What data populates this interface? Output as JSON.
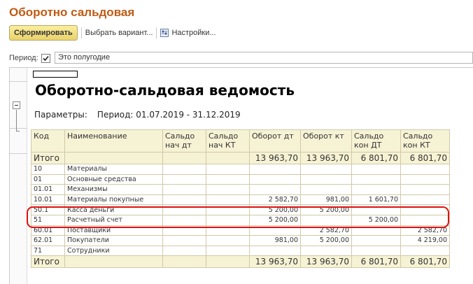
{
  "window": {
    "title": "Оборотно сальдовая"
  },
  "toolbar": {
    "generate_label": "Сформировать",
    "choose_variant_label": "Выбрать вариант...",
    "settings_label": "Настройки..."
  },
  "period": {
    "label": "Период:",
    "checked": true,
    "value": "Это полугодие"
  },
  "report": {
    "title": "Оборотно-сальдовая ведомость",
    "params_label": "Параметры:",
    "params_value": "Период: 01.07.2019 - 31.12.2019",
    "columns": [
      "Код",
      "Наименование",
      "Сальдо нач дт",
      "Сальдо нач КТ",
      "Оборот дт",
      "Оборот кт",
      "Сальдо кон ДТ",
      "Сальдо кон КТ"
    ],
    "total_top": [
      "Итого",
      "",
      "",
      "",
      "13 963,70",
      "13 963,70",
      "6 801,70",
      "6 801,70"
    ],
    "rows": [
      [
        "10",
        "Материалы",
        "",
        "",
        "",
        "",
        "",
        ""
      ],
      [
        "01",
        "Основные средства",
        "",
        "",
        "",
        "",
        "",
        ""
      ],
      [
        "01.01",
        "Механизмы",
        "",
        "",
        "",
        "",
        "",
        ""
      ],
      [
        "10.01",
        "Материалы покупные",
        "",
        "",
        "2 582,70",
        "981,00",
        "1 601,70",
        ""
      ],
      [
        "50.1",
        "Касса деньги",
        "",
        "",
        "5 200,00",
        "5 200,00",
        "",
        ""
      ],
      [
        "51",
        "Расчетный счет",
        "",
        "",
        "5 200,00",
        "",
        "5 200,00",
        ""
      ],
      [
        "60.01",
        "Поставщики",
        "",
        "",
        "",
        "2 582,70",
        "",
        "2 582,70"
      ],
      [
        "62.01",
        "Покупатели",
        "",
        "",
        "981,00",
        "5 200,00",
        "",
        "4 219,00"
      ],
      [
        "71",
        "Сотрудники",
        "",
        "",
        "",
        "",
        "",
        ""
      ]
    ],
    "total_bottom": [
      "Итого",
      "",
      "",
      "",
      "13 963,70",
      "13 963,70",
      "6 801,70",
      "6 801,70"
    ]
  },
  "colors": {
    "title": "#c05a12",
    "header_bg": "#f6f2d4",
    "highlight": "#e01010"
  }
}
